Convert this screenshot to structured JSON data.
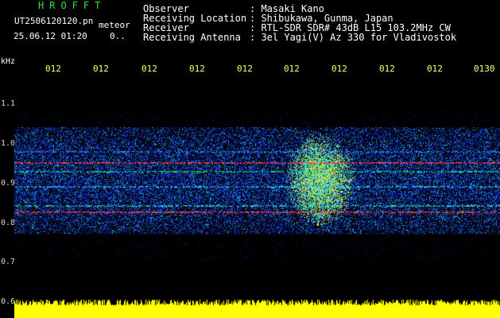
{
  "header": {
    "app_title": "HROFFT",
    "filename": "UT2506120120.pn",
    "event_type": "meteor",
    "datetime": "25.06.12 01:20",
    "count": "0..",
    "info": [
      {
        "label": "Observer",
        "value": ": Masaki Kano"
      },
      {
        "label": "Receiving Location",
        "value": ": Shibukawa, Gunma, Japan"
      },
      {
        "label": "Receiver",
        "value": ": RTL-SDR SDR# 43dB L15 103.2MHz CW"
      },
      {
        "label": "Receiving Antenna",
        "value": ": 3el Yagi(V) Az 330 for Vladivostok"
      }
    ]
  },
  "axes": {
    "y_unit": "kHz",
    "y_ticks": [
      "1.1",
      "1.0",
      "0.9",
      "0.8",
      "0.7",
      "0.6"
    ],
    "x_ticks": [
      "012",
      "012",
      "012",
      "012",
      "012",
      "012",
      "012",
      "012",
      "012",
      "0130"
    ]
  },
  "colors": {
    "background": "#000000",
    "title": "#35e035",
    "time_ticks": "#ffff66",
    "level_bar": "#ffff00",
    "noise": "#1020c0",
    "signal": "#ff3030"
  }
}
